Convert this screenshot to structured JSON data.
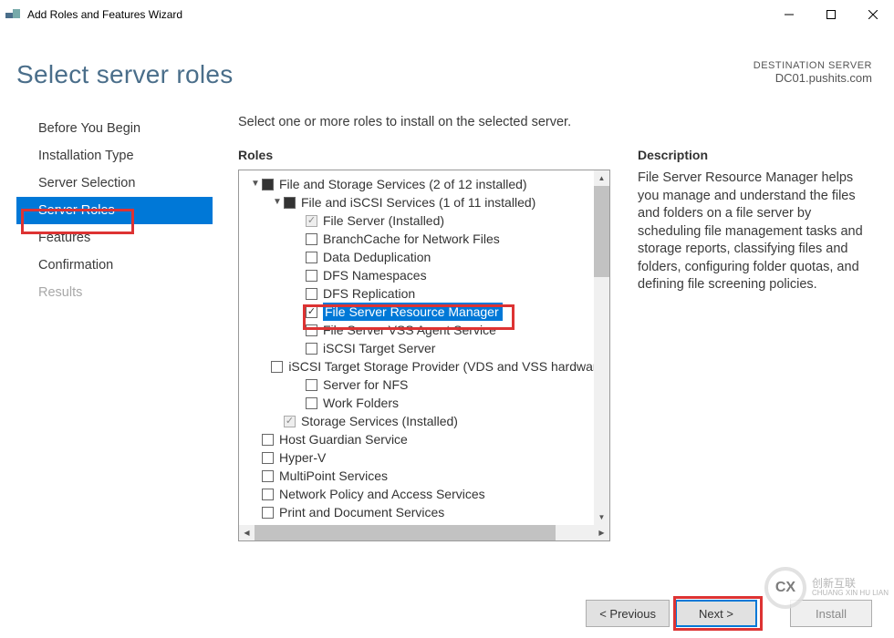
{
  "window": {
    "title": "Add Roles and Features Wizard"
  },
  "header": {
    "page_title": "Select server roles",
    "destination_label": "DESTINATION SERVER",
    "destination_name": "DC01.pushits.com"
  },
  "nav": {
    "items": [
      {
        "label": "Before You Begin",
        "state": "normal"
      },
      {
        "label": "Installation Type",
        "state": "normal"
      },
      {
        "label": "Server Selection",
        "state": "normal"
      },
      {
        "label": "Server Roles",
        "state": "active"
      },
      {
        "label": "Features",
        "state": "normal"
      },
      {
        "label": "Confirmation",
        "state": "normal"
      },
      {
        "label": "Results",
        "state": "disabled"
      }
    ]
  },
  "center": {
    "instruction": "Select one or more roles to install on the selected server.",
    "roles_head": "Roles",
    "desc_head": "Description",
    "description": "File Server Resource Manager helps you manage and understand the files and folders on a file server by scheduling file management tasks and storage reports, classifying files and folders, configuring folder quotas, and defining file screening policies."
  },
  "tree": [
    {
      "indent": 0,
      "arrow": "▼",
      "cb": "filled",
      "label": "File and Storage Services (2 of 12 installed)"
    },
    {
      "indent": 1,
      "arrow": "▼",
      "cb": "filled",
      "label": "File and iSCSI Services (1 of 11 installed)"
    },
    {
      "indent": 2,
      "arrow": "",
      "cb": "check-disabled",
      "label": "File Server (Installed)"
    },
    {
      "indent": 2,
      "arrow": "",
      "cb": "empty",
      "label": "BranchCache for Network Files"
    },
    {
      "indent": 2,
      "arrow": "",
      "cb": "empty",
      "label": "Data Deduplication"
    },
    {
      "indent": 2,
      "arrow": "",
      "cb": "empty",
      "label": "DFS Namespaces"
    },
    {
      "indent": 2,
      "arrow": "",
      "cb": "empty",
      "label": "DFS Replication"
    },
    {
      "indent": 2,
      "arrow": "",
      "cb": "check",
      "label": "File Server Resource Manager",
      "selected": true
    },
    {
      "indent": 2,
      "arrow": "",
      "cb": "empty",
      "label": "File Server VSS Agent Service"
    },
    {
      "indent": 2,
      "arrow": "",
      "cb": "empty",
      "label": "iSCSI Target Server"
    },
    {
      "indent": 2,
      "arrow": "",
      "cb": "empty",
      "label": "iSCSI Target Storage Provider (VDS and VSS hardware)"
    },
    {
      "indent": 2,
      "arrow": "",
      "cb": "empty",
      "label": "Server for NFS"
    },
    {
      "indent": 2,
      "arrow": "",
      "cb": "empty",
      "label": "Work Folders"
    },
    {
      "indent": 1,
      "arrow": "",
      "cb": "check-disabled",
      "label": "Storage Services (Installed)"
    },
    {
      "indent": 0,
      "arrow": "",
      "cb": "empty",
      "label": "Host Guardian Service"
    },
    {
      "indent": 0,
      "arrow": "",
      "cb": "empty",
      "label": "Hyper-V"
    },
    {
      "indent": 0,
      "arrow": "",
      "cb": "empty",
      "label": "MultiPoint Services"
    },
    {
      "indent": 0,
      "arrow": "",
      "cb": "empty",
      "label": "Network Policy and Access Services"
    },
    {
      "indent": 0,
      "arrow": "",
      "cb": "empty",
      "label": "Print and Document Services"
    }
  ],
  "footer": {
    "previous": "< Previous",
    "next": "Next >",
    "install": "Install"
  },
  "watermark": {
    "symbol": "CX",
    "line1": "创新互联",
    "line2": "CHUANG XIN HU LIAN"
  }
}
